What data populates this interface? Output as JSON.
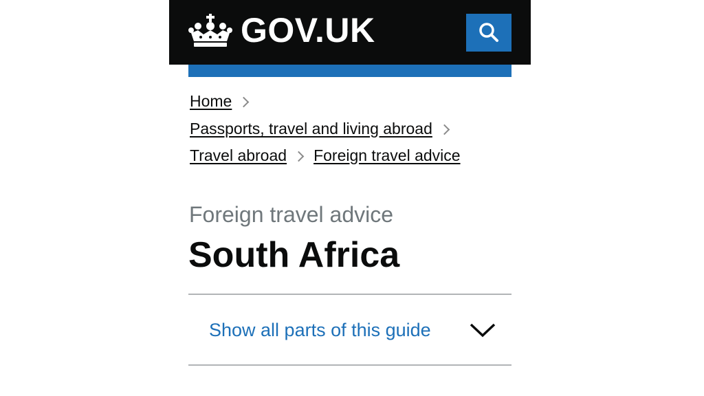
{
  "header": {
    "logo_text": "GOV.UK",
    "logo_icon": "crown-icon",
    "search_icon": "search-icon",
    "colors": {
      "header_bg": "#0b0c0c",
      "brand_blue": "#1d70b8"
    }
  },
  "breadcrumbs": [
    {
      "label": "Home"
    },
    {
      "label": "Passports, travel and living abroad"
    },
    {
      "label": "Travel abroad"
    },
    {
      "label": "Foreign travel advice"
    }
  ],
  "page": {
    "caption": "Foreign travel advice",
    "title": "South Africa"
  },
  "guide_toggle": {
    "label": "Show all parts of this guide",
    "icon": "chevron-down-icon"
  }
}
